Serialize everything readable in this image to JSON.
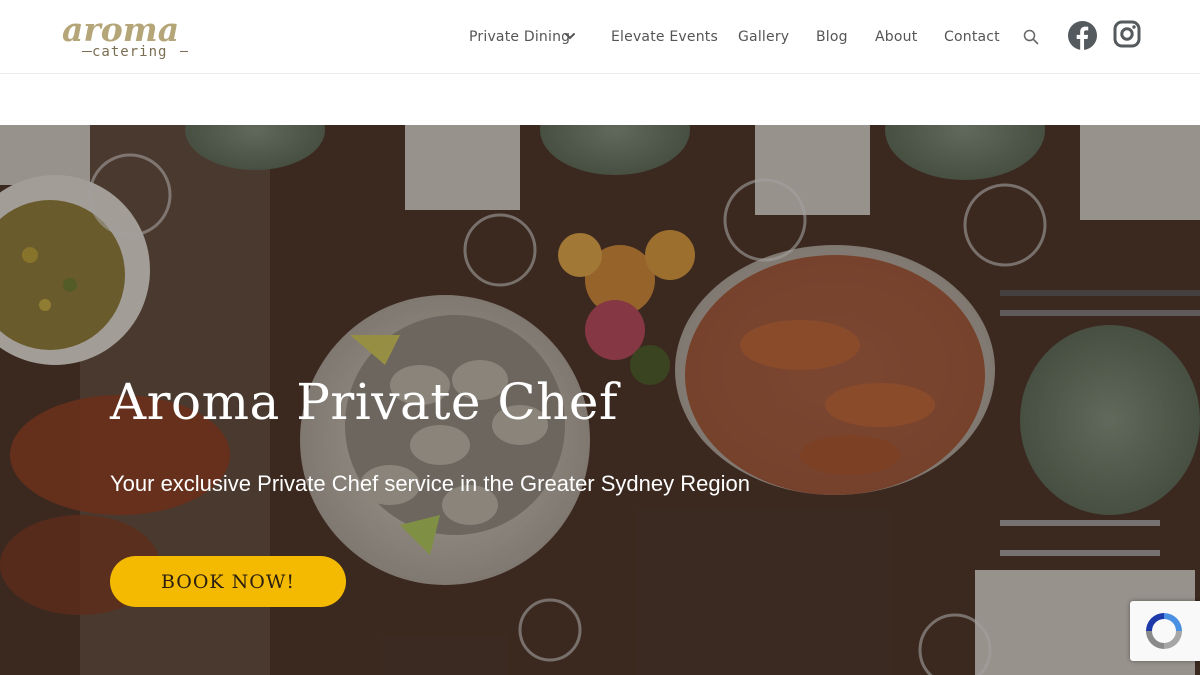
{
  "logo": {
    "main": "aroma",
    "sub": "catering"
  },
  "nav": {
    "items": [
      {
        "label": "Private Dining",
        "has_dropdown": true
      },
      {
        "label": "Elevate Events"
      },
      {
        "label": "Gallery"
      },
      {
        "label": "Blog"
      },
      {
        "label": "About"
      },
      {
        "label": "Contact"
      }
    ],
    "search_icon": "search-icon",
    "social": [
      "facebook-icon",
      "instagram-icon"
    ]
  },
  "hero": {
    "title": "Aroma Private Chef",
    "subtitle": "Your exclusive Private Chef service in the Greater Sydney Region",
    "cta": "BOOK NOW!"
  },
  "colors": {
    "accent": "#f4ba02",
    "logo": "#b5a679",
    "nav_text": "#555555",
    "hero_bg": "#3b2b22"
  },
  "recaptcha_icon": "recaptcha-icon"
}
